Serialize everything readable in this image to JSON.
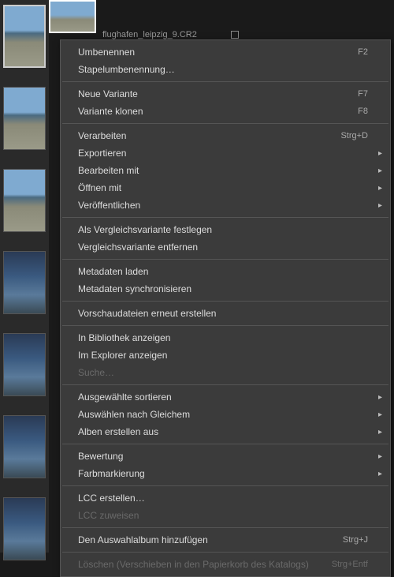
{
  "filename": "flughafen_leipzig_9.CR2",
  "menu": {
    "rename": {
      "label": "Umbenennen",
      "shortcut": "F2"
    },
    "batch_rename": {
      "label": "Stapelumbenennung…"
    },
    "new_variant": {
      "label": "Neue Variante",
      "shortcut": "F7"
    },
    "clone_variant": {
      "label": "Variante klonen",
      "shortcut": "F8"
    },
    "process": {
      "label": "Verarbeiten",
      "shortcut": "Strg+D"
    },
    "export": {
      "label": "Exportieren"
    },
    "edit_with": {
      "label": "Bearbeiten mit"
    },
    "open_with": {
      "label": "Öffnen mit"
    },
    "publish": {
      "label": "Veröffentlichen"
    },
    "set_compare": {
      "label": "Als Vergleichsvariante festlegen"
    },
    "remove_compare": {
      "label": "Vergleichsvariante entfernen"
    },
    "load_metadata": {
      "label": "Metadaten laden"
    },
    "sync_metadata": {
      "label": "Metadaten synchronisieren"
    },
    "regen_previews": {
      "label": "Vorschaudateien erneut erstellen"
    },
    "show_library": {
      "label": "In Bibliothek anzeigen"
    },
    "show_explorer": {
      "label": "Im Explorer anzeigen"
    },
    "search": {
      "label": "Suche…"
    },
    "sort_selected": {
      "label": "Ausgewählte sortieren"
    },
    "select_by_same": {
      "label": "Auswählen nach Gleichem"
    },
    "create_album": {
      "label": "Alben erstellen aus"
    },
    "rating": {
      "label": "Bewertung"
    },
    "color_tag": {
      "label": "Farbmarkierung"
    },
    "lcc_create": {
      "label": "LCC erstellen…"
    },
    "lcc_assign": {
      "label": "LCC zuweisen"
    },
    "add_to_selection_album": {
      "label": "Den Auswahlalbum hinzufügen",
      "shortcut": "Strg+J"
    },
    "delete": {
      "label": "Löschen (Verschieben in den Papierkorb des Katalogs)",
      "shortcut": "Strg+Entf"
    }
  }
}
